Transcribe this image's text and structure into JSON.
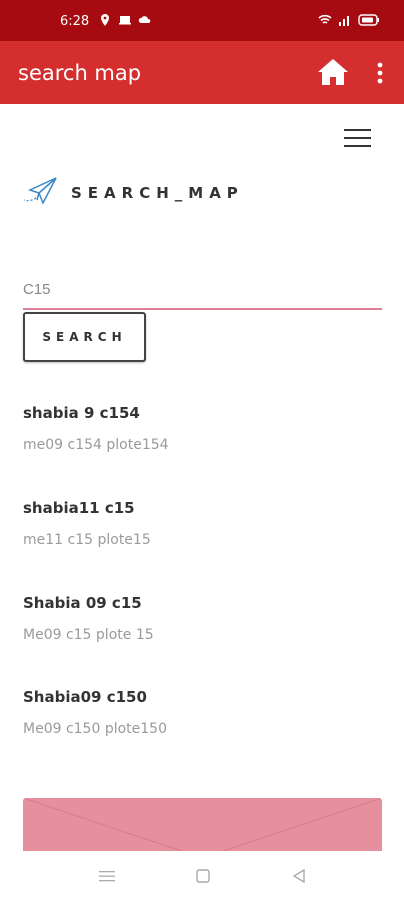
{
  "status": {
    "time": "6:28"
  },
  "app_bar": {
    "title": "search map"
  },
  "brand": {
    "name": "SEARCH_MAP"
  },
  "search": {
    "value": "C15",
    "button_label": "SEARCH"
  },
  "results": [
    {
      "title": "shabia 9 c154",
      "subtitle": "me09 c154 plote154"
    },
    {
      "title": "shabia11 c15",
      "subtitle": "me11 c15 plote15"
    },
    {
      "title": "Shabia 09 c15",
      "subtitle": "Me09 c15 plote 15"
    },
    {
      "title": "Shabia09 c150",
      "subtitle": "Me09 c150 plote150"
    }
  ],
  "colors": {
    "status_bar": "#a50b10",
    "app_bar": "#d42f2e",
    "accent_underline": "#e07e96",
    "card": "#e6909f"
  },
  "icons": {
    "home": "home-icon",
    "more": "more-vert-icon",
    "menu": "hamburger-menu-icon",
    "brand": "paper-plane-icon"
  }
}
